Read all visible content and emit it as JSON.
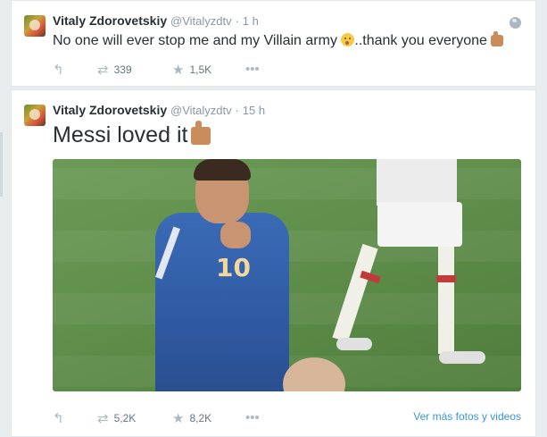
{
  "tweets": [
    {
      "fullname": "Vitaly Zdorovetskiy",
      "username": "@Vitalyzdtv",
      "separator": "·",
      "time": "1 h",
      "text_before": "No one will ever stop me and my Villain army ",
      "text_after": "..thank you everyone ",
      "retweets": "339",
      "favorites": "1,5K",
      "icons": [
        "reply-icon",
        "retweet-icon",
        "star-icon",
        "more-icon",
        "globe-icon",
        "wink-emoji-icon",
        "thumbs-up-icon"
      ]
    },
    {
      "fullname": "Vitaly Zdorovetskiy",
      "username": "@Vitalyzdtv",
      "separator": "·",
      "time": "15 h",
      "text": "Messi loved it",
      "retweets": "5,2K",
      "favorites": "8,2K",
      "more_photos_link": "Ver más fotos y videos",
      "image_overlay_number": "10",
      "icons": [
        "reply-icon",
        "retweet-icon",
        "star-icon",
        "more-icon",
        "thumbs-up-icon"
      ]
    }
  ],
  "colors": {
    "background": "#e9edf0",
    "link": "#3b94d9",
    "muted": "#8899a6",
    "text": "#292f33"
  }
}
